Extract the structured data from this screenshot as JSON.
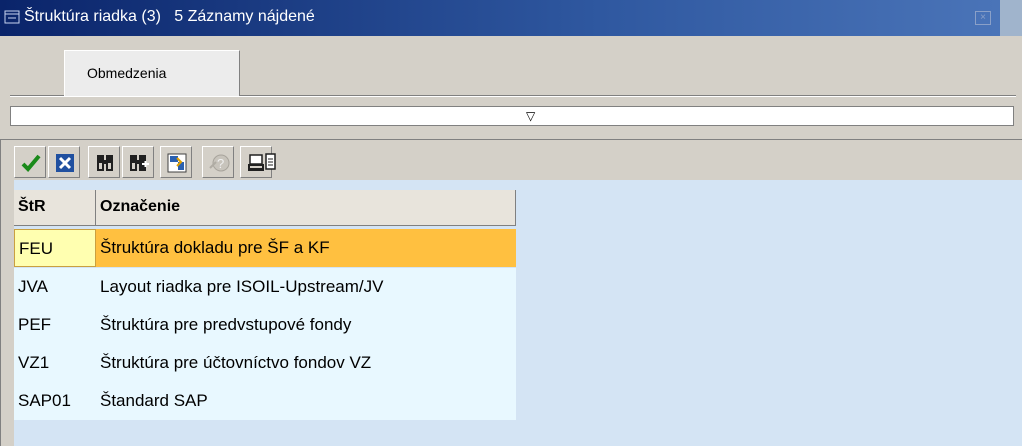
{
  "window": {
    "title": "Štruktúra riadka (3)   5 Záznamy nájdené"
  },
  "tabs": [
    {
      "label": "Obmedzenia"
    }
  ],
  "toolbar": {
    "buttons": [
      {
        "icon": "checkmark-icon"
      },
      {
        "icon": "cancel-icon"
      },
      {
        "icon": "find-icon"
      },
      {
        "icon": "find-next-icon"
      },
      {
        "icon": "select-icon"
      },
      {
        "icon": "help-icon"
      },
      {
        "icon": "print-icon"
      }
    ]
  },
  "table": {
    "headers": [
      "ŠtR",
      "Označenie"
    ],
    "rows": [
      {
        "key": "FEU",
        "value": "Štruktúra dokladu pre ŠF a KF",
        "selected": true
      },
      {
        "key": "JVA",
        "value": "Layout riadka pre ISOIL-Upstream/JV",
        "selected": false
      },
      {
        "key": "PEF",
        "value": "Štruktúra pre predvstupové fondy",
        "selected": false
      },
      {
        "key": "VZ1",
        "value": "Štruktúra pre účtovníctvo fondov VZ",
        "selected": false
      },
      {
        "key": "SAP01",
        "value": "Štandard SAP",
        "selected": false
      }
    ]
  },
  "colors": {
    "titlebar": "#0a246a",
    "selected_row": "#ffc040",
    "list_background": "#e8f8ff"
  }
}
